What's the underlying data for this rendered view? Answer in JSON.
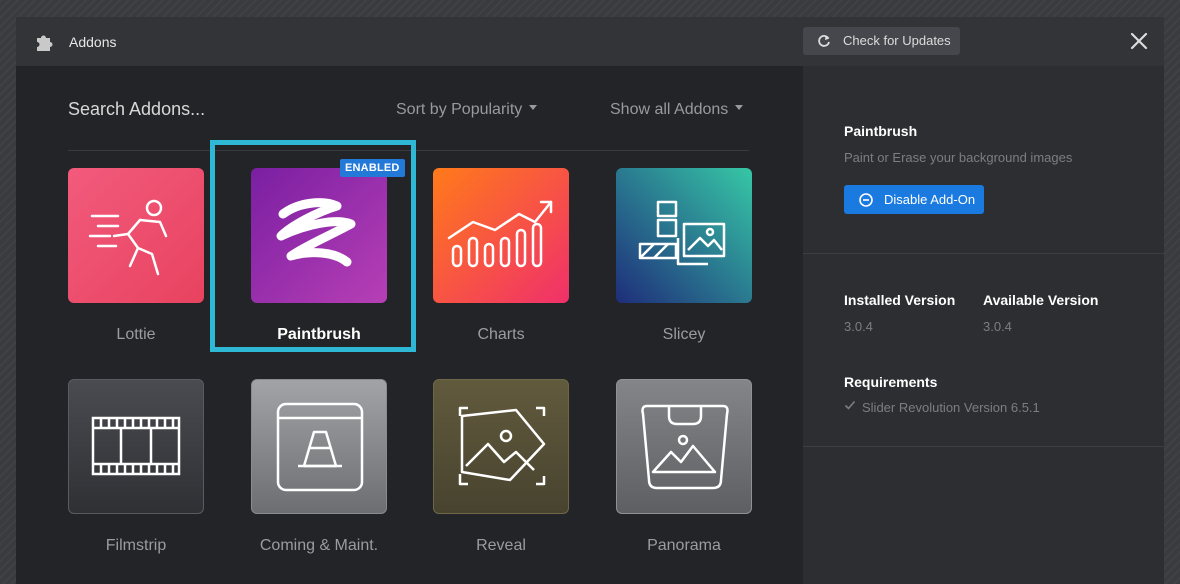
{
  "header": {
    "title": "Addons",
    "check_updates_label": "Check for Updates",
    "icons": {
      "title": "puzzle-icon",
      "refresh": "refresh-icon",
      "close": "close-icon"
    }
  },
  "filters": {
    "search_label": "Search Addons...",
    "sort_label": "Sort by Popularity",
    "show_label": "Show all Addons"
  },
  "addons": [
    {
      "name": "Lottie",
      "icon": "running-man-icon",
      "colors": [
        "#f25478",
        "#e84467"
      ]
    },
    {
      "name": "Paintbrush",
      "icon": "brush-stroke-icon",
      "selected": true,
      "badge": "ENABLED",
      "colors": [
        "#7a1fa2",
        "#b73fb5"
      ]
    },
    {
      "name": "Charts",
      "icon": "bar-chart-icon",
      "colors": [
        "#ff7a1a",
        "#f0306b"
      ]
    },
    {
      "name": "Slicey",
      "icon": "slices-icon",
      "colors": [
        "#1e2c78",
        "#30c3a5"
      ]
    },
    {
      "name": "Filmstrip",
      "icon": "filmstrip-icon",
      "colors": [
        "#2e2f33",
        "#4c4d52"
      ]
    },
    {
      "name": "Coming & Maint.",
      "icon": "traffic-cone-icon",
      "colors": [
        "#9a9b9f",
        "#717276"
      ]
    },
    {
      "name": "Reveal",
      "icon": "reveal-image-icon",
      "colors": [
        "#4c4734",
        "#625b3e"
      ]
    },
    {
      "name": "Panorama",
      "icon": "panorama-icon",
      "colors": [
        "#5f6064",
        "#7d7e82"
      ]
    }
  ],
  "detail": {
    "name": "Paintbrush",
    "description": "Paint or Erase your background images",
    "disable_label": "Disable Add-On",
    "installed_label": "Installed Version",
    "installed_value": "3.0.4",
    "available_label": "Available Version",
    "available_value": "3.0.4",
    "requirements_label": "Requirements",
    "requirement_item": "Slider Revolution Version 6.5.1",
    "accent": "#1a7ae0"
  },
  "highlight_color": "#2fb7d6"
}
